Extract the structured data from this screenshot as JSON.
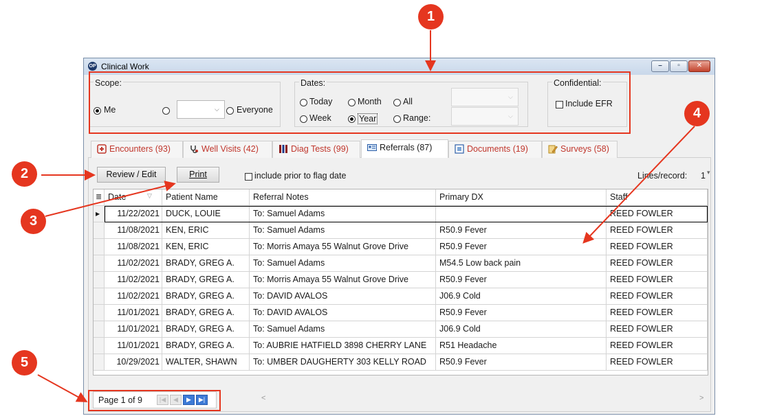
{
  "window": {
    "title": "Clinical Work"
  },
  "scope": {
    "label": "Scope:",
    "me": "Me",
    "everyone": "Everyone",
    "selected": "Me"
  },
  "dates": {
    "label": "Dates:",
    "today": "Today",
    "month": "Month",
    "all": "All",
    "week": "Week",
    "year": "Year",
    "range": "Range:",
    "selected": "Year"
  },
  "confidential": {
    "label": "Confidential:",
    "include_efr": "Include EFR"
  },
  "tabs": [
    {
      "label": "Encounters (93)",
      "icon": "encounters-icon"
    },
    {
      "label": "Well Visits (42)",
      "icon": "stethoscope-icon"
    },
    {
      "label": "Diag Tests (99)",
      "icon": "test-tubes-icon"
    },
    {
      "label": "Referrals (87)",
      "icon": "referral-card-icon",
      "active": true
    },
    {
      "label": "Documents (19)",
      "icon": "documents-icon"
    },
    {
      "label": "Surveys (58)",
      "icon": "survey-pencil-icon"
    }
  ],
  "toolbar": {
    "review_edit": "Review / Edit",
    "print": "Print",
    "include_prior": "include prior to flag date",
    "lines_per_record_label": "Lines/record:",
    "lines_per_record_value": "1"
  },
  "grid": {
    "columns": [
      "Date",
      "Patient Name",
      "Referral Notes",
      "Primary DX",
      "Staff"
    ],
    "rows": [
      [
        "11/22/2021",
        "DUCK, LOUIE",
        "To: Samuel Adams",
        "",
        "REED FOWLER"
      ],
      [
        "11/08/2021",
        "KEN, ERIC",
        "To: Samuel Adams",
        "R50.9 Fever",
        "REED FOWLER"
      ],
      [
        "11/08/2021",
        "KEN, ERIC",
        "To: Morris Amaya 55 Walnut Grove Drive",
        "R50.9 Fever",
        "REED FOWLER"
      ],
      [
        "11/02/2021",
        "BRADY, GREG A.",
        "To: Samuel Adams",
        "M54.5 Low back pain",
        "REED FOWLER"
      ],
      [
        "11/02/2021",
        "BRADY, GREG A.",
        "To: Morris Amaya 55 Walnut Grove Drive",
        "R50.9 Fever",
        "REED FOWLER"
      ],
      [
        "11/02/2021",
        "BRADY, GREG A.",
        "To: DAVID AVALOS",
        "J06.9 Cold",
        "REED FOWLER"
      ],
      [
        "11/01/2021",
        "BRADY, GREG A.",
        "To: DAVID AVALOS",
        "R50.9 Fever",
        "REED FOWLER"
      ],
      [
        "11/01/2021",
        "BRADY, GREG A.",
        "To: Samuel Adams",
        "J06.9 Cold",
        "REED FOWLER"
      ],
      [
        "11/01/2021",
        "BRADY, GREG A.",
        "To: AUBRIE HATFIELD 3898 CHERRY LANE",
        "R51 Headache",
        "REED FOWLER"
      ],
      [
        "10/29/2021",
        "WALTER, SHAWN",
        "To: UMBER DAUGHERTY 303 KELLY ROAD",
        "R50.9 Fever",
        "REED FOWLER"
      ]
    ]
  },
  "pager": {
    "text": "Page 1 of 9"
  },
  "callouts": [
    "1",
    "2",
    "3",
    "4",
    "5"
  ],
  "colors": {
    "callout_red": "#e5361f",
    "tab_text_red": "#c0362c"
  }
}
